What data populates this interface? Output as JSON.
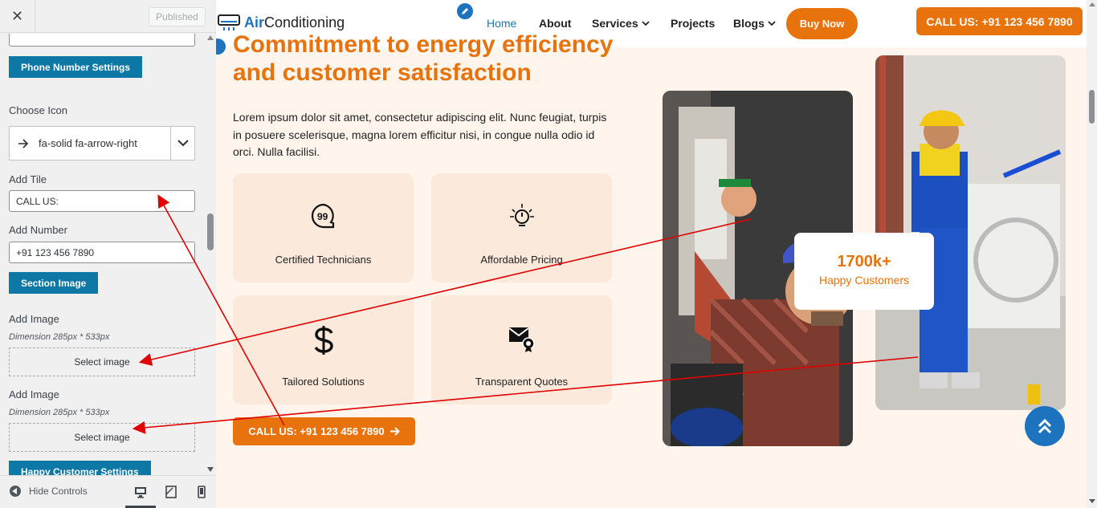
{
  "sidebar": {
    "close_label": "✕",
    "published_label": "Published",
    "phone_settings_label": "Phone Number Settings",
    "choose_icon_label": "Choose Icon",
    "icon_value": "fa-solid fa-arrow-right",
    "add_title_label": "Add Tile",
    "title_value": "CALL US:",
    "add_number_label": "Add Number",
    "number_value": "+91 123 456 7890",
    "section_image_label": "Section Image",
    "images": [
      {
        "label": "Add Image",
        "hint": "Dimension 285px * 533px",
        "button": "Select image"
      },
      {
        "label": "Add Image",
        "hint": "Dimension 285px * 533px",
        "button": "Select image"
      }
    ],
    "happy_settings_label": "Happy Customer Settings",
    "hide_controls_label": "Hide Controls"
  },
  "header": {
    "logo_brand": "Air",
    "logo_rest": "Conditioning",
    "nav": [
      {
        "label": "Home",
        "active": true
      },
      {
        "label": "About"
      },
      {
        "label": "Services",
        "dropdown": true
      },
      {
        "label": "Projects"
      },
      {
        "label": "Blogs",
        "dropdown": true
      }
    ],
    "buy_label": "Buy Now",
    "call_label": "CALL US: +91 123 456 7890"
  },
  "section": {
    "headline_1": "Commitment to energy efficiency",
    "headline_2": "and customer satisfaction",
    "paragraph": "Lorem ipsum dolor sit amet, consectetur adipiscing elit. Nunc feugiat, turpis in posuere scelerisque, magna lorem efficitur nisi, in congue nulla odio id orci. Nulla facilisi.",
    "features": [
      {
        "label": "Certified Technicians",
        "icon": "quote-99-icon"
      },
      {
        "label": "Affordable Pricing",
        "icon": "power-bulb-icon"
      },
      {
        "label": "Tailored Solutions",
        "icon": "dollar-icon"
      },
      {
        "label": "Transparent Quotes",
        "icon": "mail-badge-icon"
      }
    ],
    "cta_label": "CALL US: +91 123 456 7890",
    "happy_count": "1700k+",
    "happy_text": "Happy Customers"
  },
  "colors": {
    "accent": "#e8720c",
    "brand_blue": "#1e73be",
    "wp_blue": "#0d77a6",
    "section_bg": "#fff5ec",
    "card_bg": "#fbeadc",
    "annotation": "#e00000"
  }
}
